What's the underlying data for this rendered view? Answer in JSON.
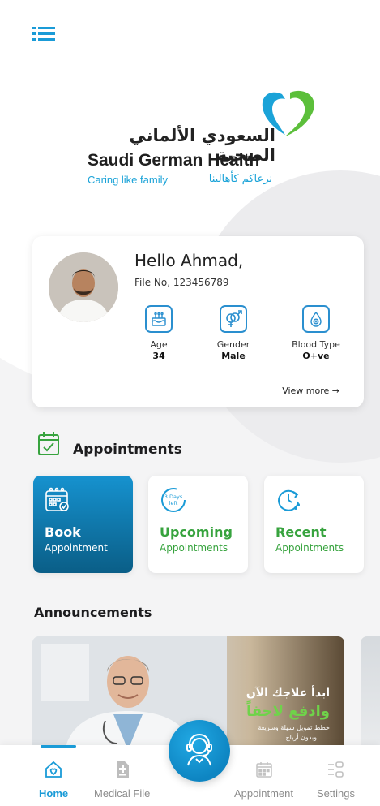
{
  "brand": {
    "name_ar": "السعودي الألماني الصحية",
    "name_en": "Saudi German Health",
    "tagline_en": "Caring like family",
    "tagline_ar": "نرعاكم كأهالينا",
    "colors": {
      "blue": "#1ba3d8",
      "green": "#37a33e"
    }
  },
  "header": {
    "menu_icon": "list-menu-icon"
  },
  "profile": {
    "greeting": "Hello Ahmad,",
    "file_no": "File No, 123456789",
    "stats": [
      {
        "label": "Age",
        "value": "34",
        "icon": "birthday-cake-icon"
      },
      {
        "label": "Gender",
        "value": "Male",
        "icon": "gender-icon"
      },
      {
        "label": "Blood Type",
        "value": "O+ve",
        "icon": "blood-drop-icon"
      }
    ],
    "view_more": "View more →"
  },
  "appointments": {
    "title": "Appointments",
    "tiles": [
      {
        "title": "Book",
        "subtitle": "Appointment",
        "icon": "calendar-grid-icon"
      },
      {
        "title": "Upcoming",
        "subtitle": "Appointments",
        "icon": "days-left-icon",
        "badge": "3 Days left"
      },
      {
        "title": "Recent",
        "subtitle": "Appointments",
        "icon": "clock-history-icon"
      }
    ]
  },
  "announcements": {
    "title": "Announcements",
    "banner": {
      "line1": "ابدأ علاجك الآن",
      "line2": "وادفع لاحقاً",
      "line3": "خطط تمويل سهلة وسريعة",
      "line4": "وبدون أرباح"
    }
  },
  "nav": {
    "items": [
      {
        "label": "Home",
        "icon": "home-heart-icon",
        "active": true
      },
      {
        "label": "Medical File",
        "icon": "medical-file-icon"
      },
      {
        "label": "Appointment",
        "icon": "calendar-icon"
      },
      {
        "label": "Settings",
        "icon": "settings-sliders-icon"
      }
    ],
    "center_icon": "support-agent-icon"
  }
}
